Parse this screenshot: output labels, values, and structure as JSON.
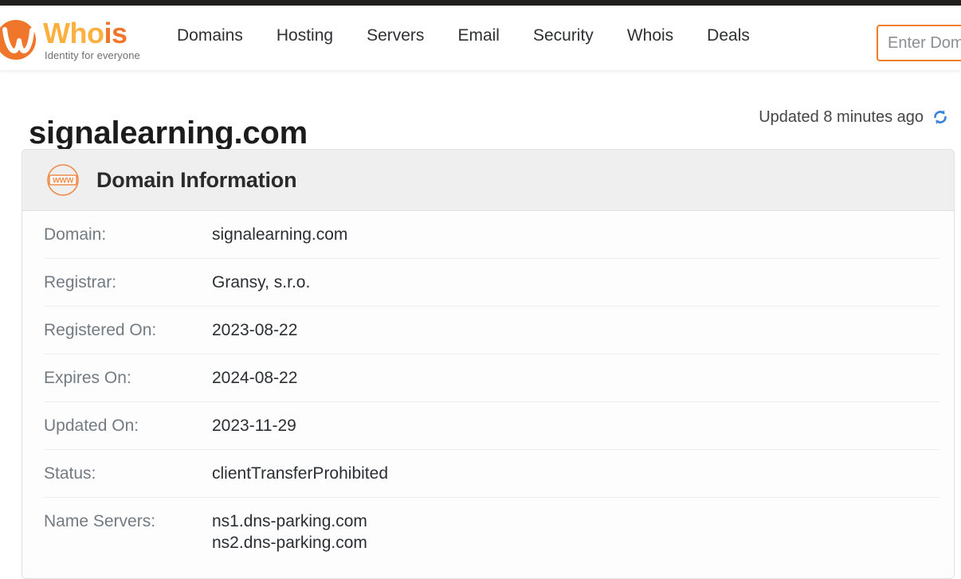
{
  "colors": {
    "brand_light": "#fbb040",
    "brand_dark": "#f0762b",
    "accent_orange": "#ef7e26",
    "refresh_blue": "#3b82dc",
    "top_strip": "#221f1f",
    "card_header_bg": "#efefef"
  },
  "header": {
    "logo": {
      "icon_name": "whois-logo-mark",
      "word_part1": "Who",
      "word_part2": "is",
      "tagline": "Identity for everyone"
    },
    "nav": [
      {
        "label": "Domains"
      },
      {
        "label": "Hosting"
      },
      {
        "label": "Servers"
      },
      {
        "label": "Email"
      },
      {
        "label": "Security"
      },
      {
        "label": "Whois"
      },
      {
        "label": "Deals"
      }
    ],
    "search": {
      "placeholder": "Enter Domain Name",
      "value": ""
    }
  },
  "main": {
    "page_title": "signalearning.com",
    "updated": {
      "text": "Updated 8 minutes ago",
      "icon_name": "refresh-icon"
    },
    "card": {
      "icon_name": "www-globe-icon",
      "icon_text": "WWW",
      "title": "Domain Information",
      "rows": [
        {
          "label": "Domain:",
          "value": "signalearning.com"
        },
        {
          "label": "Registrar:",
          "value": "Gransy, s.r.o."
        },
        {
          "label": "Registered On:",
          "value": "2023-08-22"
        },
        {
          "label": "Expires On:",
          "value": "2024-08-22"
        },
        {
          "label": "Updated On:",
          "value": "2023-11-29"
        },
        {
          "label": "Status:",
          "value": "clientTransferProhibited"
        },
        {
          "label": "Name Servers:",
          "value": "ns1.dns-parking.com\nns2.dns-parking.com"
        }
      ]
    }
  }
}
